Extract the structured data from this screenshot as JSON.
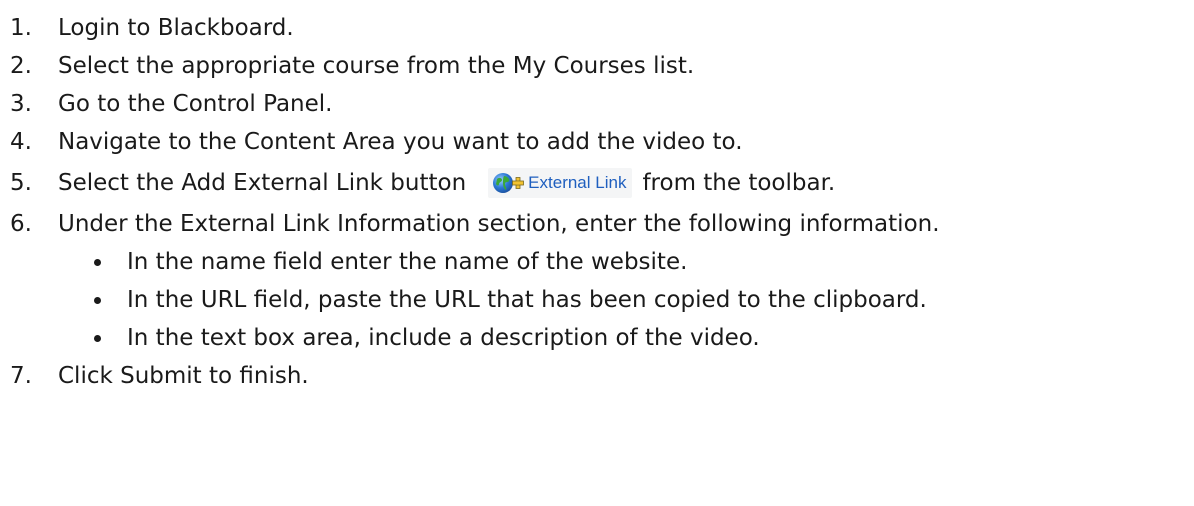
{
  "steps": [
    {
      "num": "1.",
      "text": "Login to Blackboard."
    },
    {
      "num": "2.",
      "text": "Select the appropriate course from the My Courses list."
    },
    {
      "num": "3.",
      "text": "Go to the Control Panel."
    },
    {
      "num": "4.",
      "text": "Navigate to the Content Area you want to add the video to."
    },
    {
      "num": "5.",
      "text_before": "Select the Add External Link button",
      "text_after": "from the toolbar."
    },
    {
      "num": "6.",
      "text": "Under the External Link Information section, enter the following information."
    },
    {
      "num": "7.",
      "text": "Click Submit to finish."
    }
  ],
  "sub_steps": [
    "In the name field enter the name of the website.",
    "In the URL field, paste the URL that has been copied to the clipboard.",
    "In the text box area, include a description of the video."
  ],
  "external_link_button": {
    "label": "External Link",
    "icon": "globe-plus-icon",
    "label_color": "#1f5fbf",
    "background": "#f4f5f6"
  }
}
